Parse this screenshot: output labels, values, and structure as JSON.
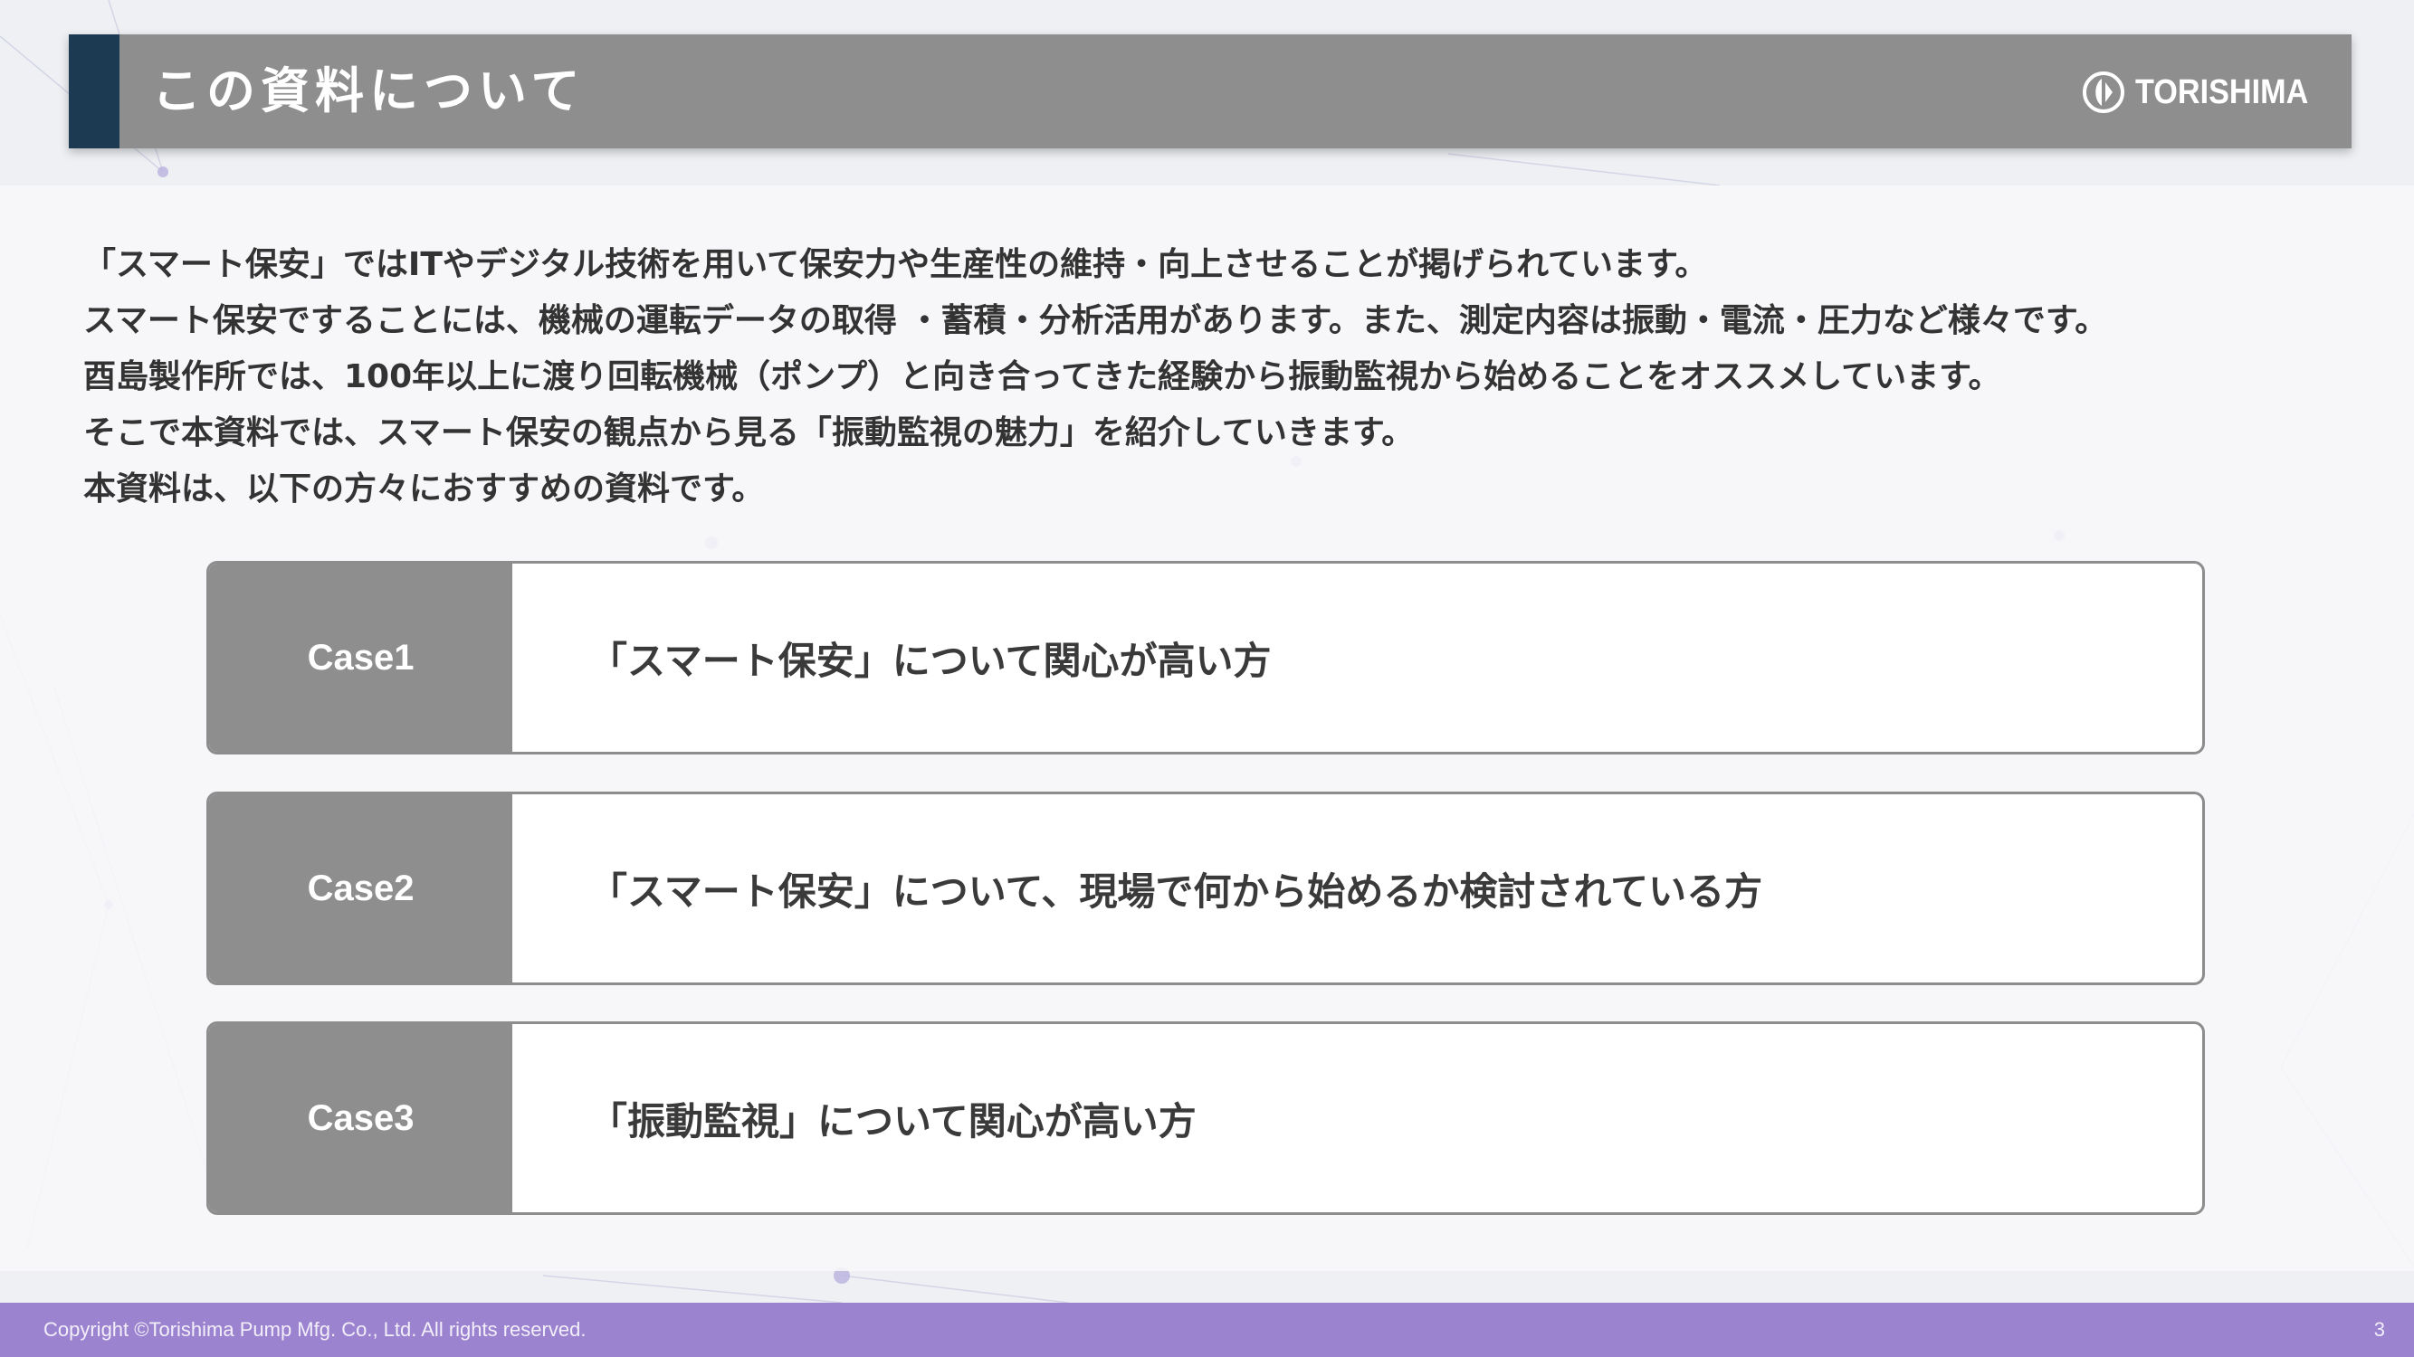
{
  "header": {
    "title": "この資料について",
    "logo_text": "TORISHIMA"
  },
  "intro": {
    "lines": [
      "「スマート保安」ではITやデジタル技術を用いて保安力や生産性の維持・向上させることが掲げられています。",
      "スマート保安ですることには、機械の運転データの取得 ・蓄積・分析活用があります。また、測定内容は振動・電流・圧力など様々です。",
      "酉島製作所では、100年以上に渡り回転機械（ポンプ）と向き合ってきた経験から振動監視から始めることをオススメしています。",
      "そこで本資料では、スマート保安の観点から見る「振動監視の魅力」を紹介していきます。",
      "本資料は、以下の方々におすすめの資料です。"
    ]
  },
  "cases": [
    {
      "label": "Case1",
      "text": "「スマート保安」について関心が高い方"
    },
    {
      "label": "Case2",
      "text": "「スマート保安」について、現場で何から始めるか検討されている方"
    },
    {
      "label": "Case3",
      "text": "「振動監視」について関心が高い方"
    }
  ],
  "footer": {
    "copyright": "Copyright ©Torishima Pump Mfg. Co., Ltd. All rights reserved.",
    "page_number": "3"
  },
  "colors": {
    "header_bar": "#8e8e8e",
    "header_accent": "#1c3a52",
    "case_label_bg": "#8e8e8e",
    "footer_bg": "#9b83cf",
    "body_text": "#333333"
  },
  "icons": {
    "logo": "torishima-logo-mark"
  }
}
